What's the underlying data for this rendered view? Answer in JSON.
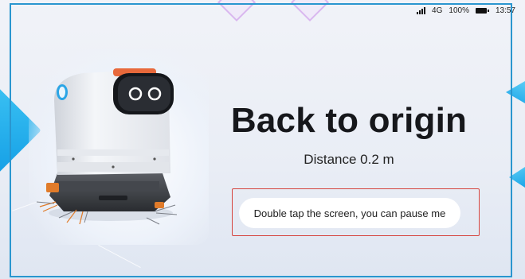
{
  "status_bar": {
    "network": "4G",
    "battery": "100%",
    "time": "13:57"
  },
  "main": {
    "title": "Back to origin",
    "distance": "Distance 0.2 m",
    "hint": "Double tap the screen, you can pause me"
  },
  "colors": {
    "screen_border": "#2a96cf",
    "accent_blue": "#16a0e6",
    "highlight_border": "#d6443e",
    "title_text": "#16171b"
  },
  "icons": [
    "signal-icon",
    "battery-icon",
    "robot-illustration"
  ]
}
